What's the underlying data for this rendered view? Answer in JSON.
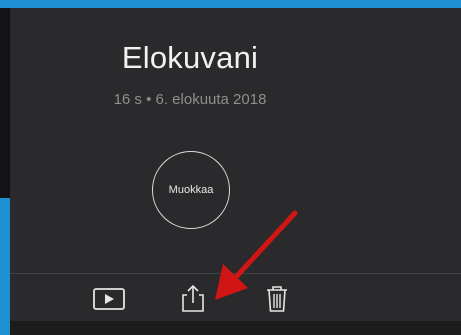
{
  "project": {
    "title": "Elokuvani",
    "meta": "16 s • 6. elokuuta 2018"
  },
  "edit_button": {
    "label": "Muokkaa"
  },
  "toolbar": {
    "items": [
      {
        "icon": "play-icon"
      },
      {
        "icon": "share-icon"
      },
      {
        "icon": "trash-icon"
      }
    ]
  },
  "colors": {
    "screen_bg": "#2a2a2c",
    "frame_blue": "#1e8fd0",
    "annotation_arrow": "#d01515"
  }
}
